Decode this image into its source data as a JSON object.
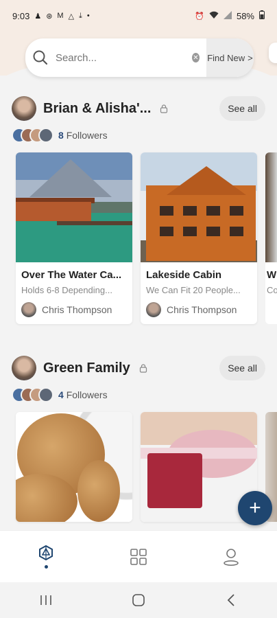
{
  "status_bar": {
    "time": "9:03",
    "battery": "58%"
  },
  "search": {
    "placeholder": "Search...",
    "find_new_label": "Find New",
    "find_new_arrow": ">"
  },
  "groups": [
    {
      "title": "Brian & Alisha'...",
      "see_all_label": "See all",
      "followers_count": "8",
      "followers_label": "Followers",
      "cards": [
        {
          "title": "Over The Water Ca...",
          "subtitle": "Holds 6-8 Depending...",
          "author": "Chris Thompson"
        },
        {
          "title": "Lakeside Cabin",
          "subtitle": "We Can Fit 20 People...",
          "author": "Chris Thompson"
        }
      ],
      "peek_title": "W",
      "peek_subtitle": "Co"
    },
    {
      "title": "Green Family",
      "see_all_label": "See all",
      "followers_count": "4",
      "followers_label": "Followers"
    }
  ],
  "fab_label": "+",
  "bottom_nav": {
    "items": [
      "explore",
      "collections",
      "profile"
    ],
    "active": "explore"
  },
  "colors": {
    "accent": "#1f4670",
    "header_bg": "#f6ece4",
    "page_bg": "#f3f3f3"
  }
}
